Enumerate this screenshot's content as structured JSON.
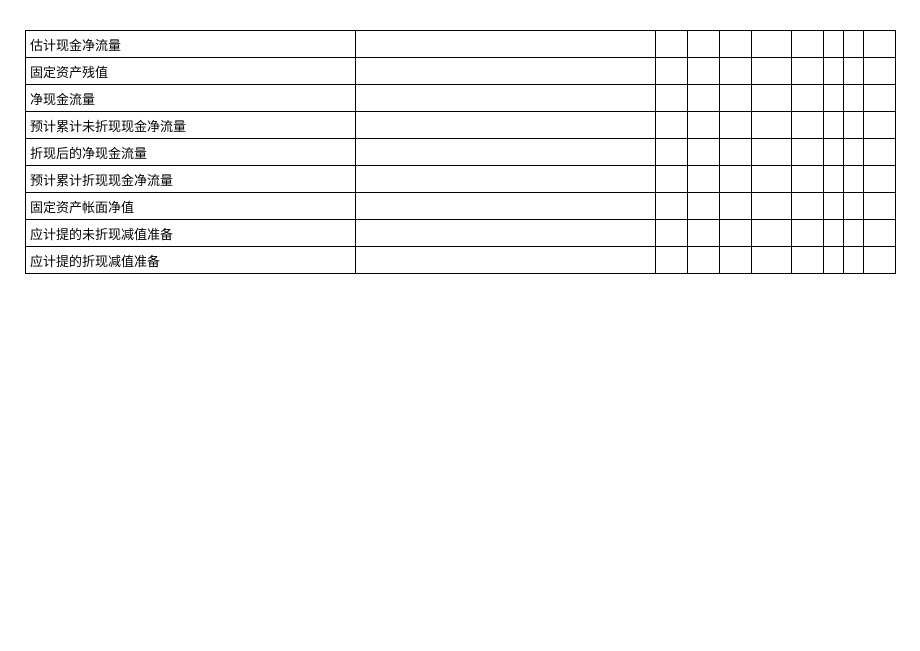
{
  "table": {
    "rows": [
      {
        "label": "估计现金净流量"
      },
      {
        "label": "固定资产残值"
      },
      {
        "label": "净现金流量"
      },
      {
        "label": "预计累计未折现现金净流量"
      },
      {
        "label": "折现后的净现金流量"
      },
      {
        "label": "预计累计折现现金净流量"
      },
      {
        "label": "固定资产帐面净值"
      },
      {
        "label": "应计提的未折现减值准备"
      },
      {
        "label": "应计提的折现减值准备"
      }
    ]
  }
}
